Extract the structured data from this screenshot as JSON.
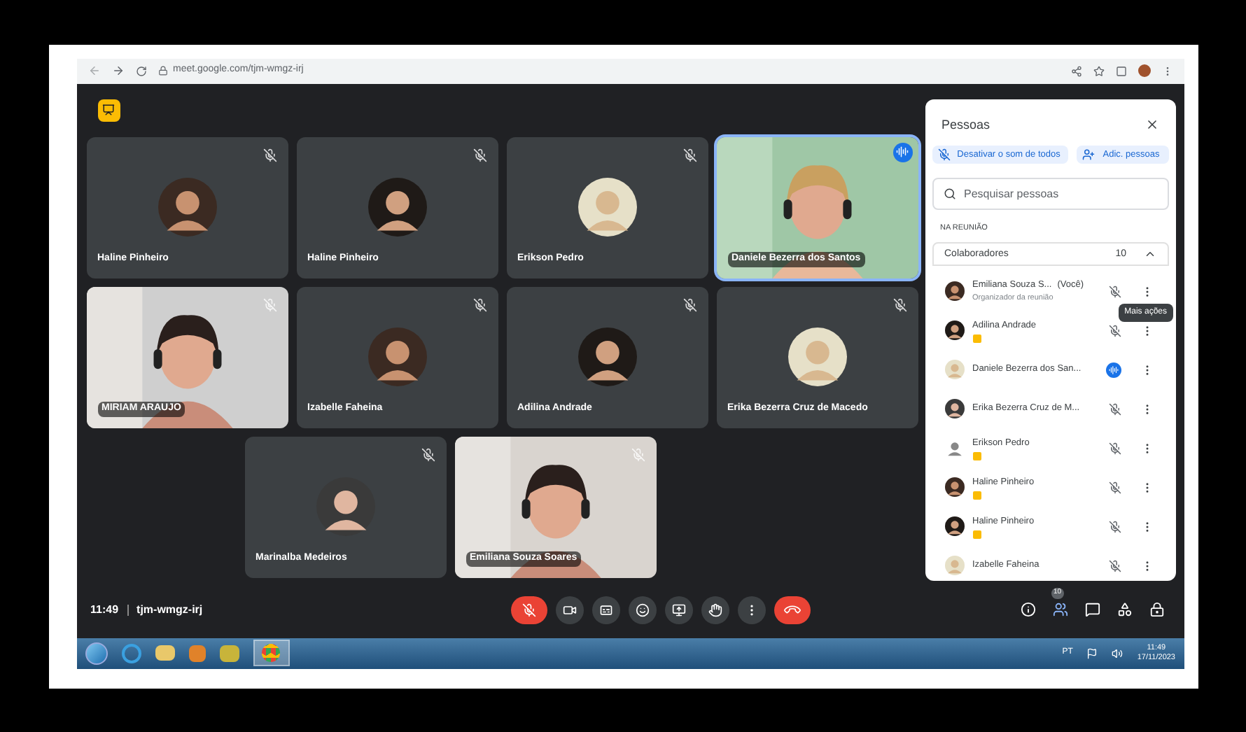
{
  "browser": {
    "url": "meet.google.com/tjm-wmgz-irj"
  },
  "tiles": [
    {
      "name": "Haline Pinheiro",
      "kind": "avatar",
      "muted": true,
      "speaking": false
    },
    {
      "name": "Haline Pinheiro",
      "kind": "avatar",
      "muted": true,
      "speaking": false
    },
    {
      "name": "Erikson Pedro",
      "kind": "avatar",
      "muted": true,
      "speaking": false
    },
    {
      "name": "Daniele Bezerra dos Santos",
      "kind": "video",
      "muted": false,
      "speaking": true
    },
    {
      "name": "MIRIAM ARAUJO",
      "kind": "video",
      "muted": true,
      "speaking": false
    },
    {
      "name": "Izabelle Faheina",
      "kind": "avatar",
      "muted": true,
      "speaking": false
    },
    {
      "name": "Adilina Andrade",
      "kind": "avatar",
      "muted": true,
      "speaking": false
    },
    {
      "name": "Erika Bezerra Cruz de Macedo",
      "kind": "avatar",
      "muted": true,
      "speaking": false
    },
    {
      "name": "Marinalba Medeiros",
      "kind": "avatar",
      "muted": true,
      "speaking": false
    },
    {
      "name": "Emiliana Souza Soares",
      "kind": "video",
      "muted": true,
      "speaking": false
    }
  ],
  "meeting": {
    "time": "11:49",
    "code": "tjm-wmgz-irj",
    "people_count": "10"
  },
  "panel": {
    "title": "Pessoas",
    "mute_all": "Desativar o som de todos",
    "add_people": "Adic. pessoas",
    "search_placeholder": "Pesquisar pessoas",
    "section": "NA REUNIÃO",
    "group": "Colaboradores",
    "group_count": "10",
    "expanded": true,
    "tooltip": "Mais ações",
    "participants": [
      {
        "name": "Emiliana Souza S...",
        "tag": "(Você)",
        "subtitle": "Organizador da reunião",
        "badge": false,
        "muted": true,
        "speaking": false
      },
      {
        "name": "Adilina Andrade",
        "badge": true,
        "muted": true,
        "speaking": false
      },
      {
        "name": "Daniele Bezerra dos San...",
        "badge": false,
        "muted": false,
        "speaking": true
      },
      {
        "name": "Erika Bezerra Cruz de M...",
        "badge": false,
        "muted": true,
        "speaking": false
      },
      {
        "name": "Erikson Pedro",
        "badge": true,
        "muted": true,
        "speaking": false
      },
      {
        "name": "Haline Pinheiro",
        "badge": true,
        "muted": true,
        "speaking": false
      },
      {
        "name": "Haline Pinheiro",
        "badge": true,
        "muted": true,
        "speaking": false
      },
      {
        "name": "Izabelle Faheina",
        "badge": false,
        "muted": true,
        "speaking": false
      }
    ]
  },
  "taskbar": {
    "language": "PT",
    "time": "11:49",
    "date": "17/11/2023"
  }
}
